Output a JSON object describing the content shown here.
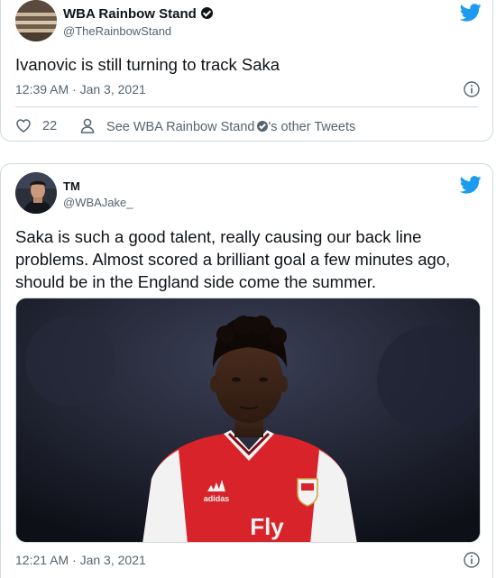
{
  "tweet1": {
    "author_name": "WBA Rainbow Stand",
    "author_handle": "@TheRainbowStand",
    "text": "Ivanovic is still turning to track Saka",
    "timestamp": "12:39 AM · Jan 3, 2021",
    "like_count": "22",
    "other_tweets_prefix": "See WBA Rainbow Stand",
    "other_tweets_suffix": "'s other Tweets",
    "icons": [
      "twitter-bird-icon",
      "info-icon",
      "heart-icon",
      "person-icon",
      "verified-icon"
    ]
  },
  "tweet2": {
    "author_name": "TM",
    "author_handle": "@WBAJake_",
    "text": "Saka is such a good talent, really causing our back line problems. Almost scored a brilliant goal a few minutes ago, should be in the England side come the summer.",
    "timestamp": "12:21 AM · Jan 3, 2021",
    "shirt_text_adidas": "adidas",
    "shirt_text_sponsor": "Fly",
    "icons": [
      "twitter-bird-icon",
      "info-icon"
    ]
  },
  "colors": {
    "brand_blue": "#1d9bf0",
    "text_primary": "#0f1419",
    "text_secondary": "#536471",
    "border": "#cfd9de",
    "arsenal_red": "#d8232a"
  }
}
